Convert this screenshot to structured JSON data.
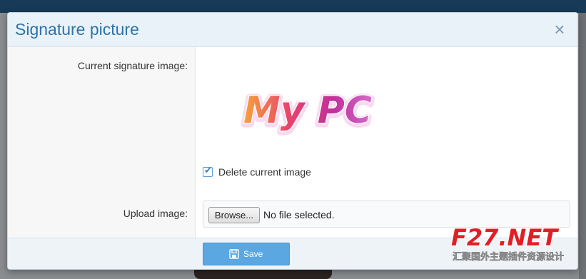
{
  "dialog": {
    "title": "Signature picture",
    "close_glyph": "×"
  },
  "form": {
    "current_image_label": "Current signature image:",
    "signature_text": "My PC",
    "delete_checkbox": {
      "label": "Delete current image",
      "checked": true
    },
    "upload_label": "Upload image:",
    "browse_label": "Browse...",
    "file_status": "No file selected."
  },
  "footer": {
    "save_label": "Save",
    "save_icon": "floppy-disk-icon"
  },
  "watermark": {
    "brand": "F27.NET",
    "tagline": "汇聚国外主题插件资源设计"
  },
  "colors": {
    "title": "#2c73a9",
    "save_button": "#5aa7e2",
    "top_bar": "#163a57",
    "watermark_red": "#e21f26"
  }
}
